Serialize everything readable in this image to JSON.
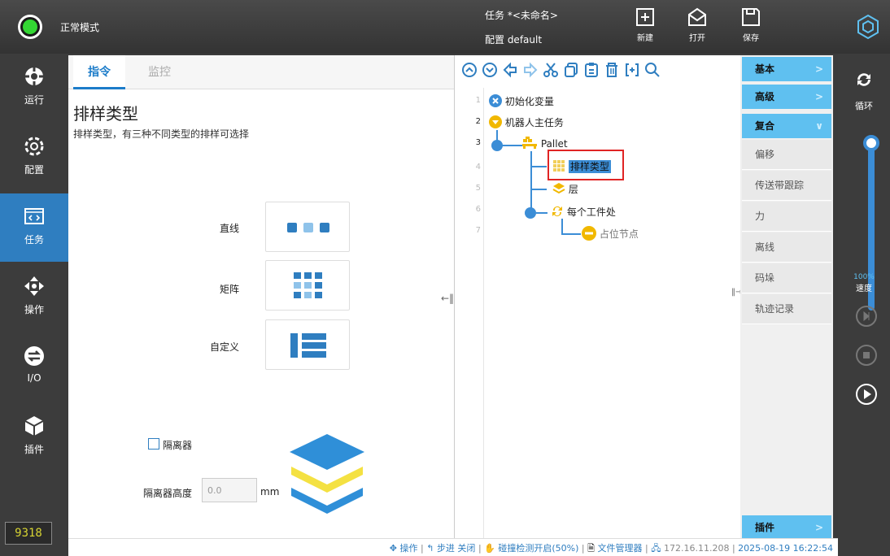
{
  "topbar": {
    "mode": "正常模式",
    "task_line": "任务 *<未命名>",
    "config_line": "配置 default",
    "new_label": "新建",
    "open_label": "打开",
    "save_label": "保存",
    "power_color": "#33d633"
  },
  "leftnav": [
    {
      "label": "运行",
      "icon": "run-icon"
    },
    {
      "label": "配置",
      "icon": "config-gear-icon"
    },
    {
      "label": "任务",
      "icon": "task-code-icon",
      "active": true
    },
    {
      "label": "操作",
      "icon": "move-arrows-icon"
    },
    {
      "label": "I/O",
      "icon": "io-icon"
    },
    {
      "label": "插件",
      "icon": "plugin-cube-icon"
    }
  ],
  "counter": "9318",
  "left_panel": {
    "tabs": [
      "指令",
      "监控"
    ],
    "title": "排样类型",
    "description": "排样类型，有三种不同类型的排样可选择",
    "options": [
      "直线",
      "矩阵",
      "自定义"
    ],
    "separator_label": "隔离器",
    "separator_height_label": "隔离器高度",
    "separator_height_value": "0.0",
    "separator_unit": "mm"
  },
  "tree": {
    "line_numbers": [
      "1",
      "2",
      "3",
      "4",
      "5",
      "6",
      "7"
    ],
    "nodes": [
      "初始化变量",
      "机器人主任务",
      "Pallet",
      "排样类型",
      "层",
      "每个工件处",
      "占位节点"
    ]
  },
  "categories": {
    "basic": "基本",
    "advanced": "高级",
    "composite": "复合",
    "items": [
      "偏移",
      "传送带跟踪",
      "力",
      "离线",
      "码垛",
      "轨迹记录"
    ],
    "plugin": "插件"
  },
  "farright": {
    "loop_label": "循环",
    "speed_value": "100%",
    "speed_label": "速度",
    "speed_level": 1.0
  },
  "statusbar": {
    "operate": "操作",
    "step": "步进 关闭",
    "collision": "碰撞检测开启(50%)",
    "file_manager": "文件管理器",
    "ip": "172.16.11.208",
    "datetime": "2025-08-19 16:22:54"
  },
  "colors": {
    "accent": "#2f7ec0",
    "category_head": "#5fc0f0",
    "selection_outline": "#e02424"
  }
}
